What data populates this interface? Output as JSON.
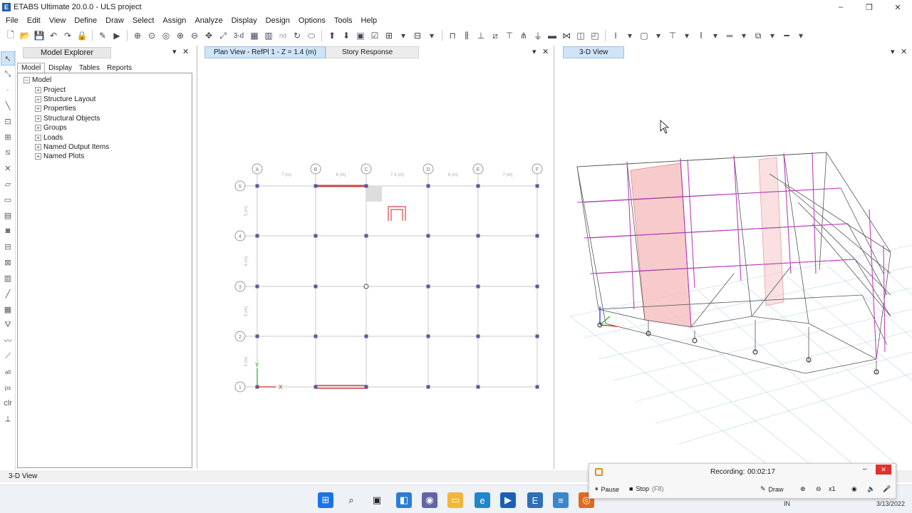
{
  "window": {
    "title": "ETABS Ultimate 20.0.0 - ULS project",
    "app_icon_letter": "E",
    "minimize": "–",
    "maximize": "❐",
    "close": "✕"
  },
  "menu": [
    "File",
    "Edit",
    "View",
    "Define",
    "Draw",
    "Select",
    "Assign",
    "Analyze",
    "Display",
    "Design",
    "Options",
    "Tools",
    "Help"
  ],
  "toolbar": {
    "view3d_label": "3-d",
    "plan_label": "nd"
  },
  "explorer": {
    "title": "Model Explorer",
    "tabs": [
      "Model",
      "Display",
      "Tables",
      "Reports"
    ],
    "root": "Model",
    "items": [
      "Project",
      "Structure Layout",
      "Properties",
      "Structural Objects",
      "Groups",
      "Loads",
      "Named Output Items",
      "Named Plots"
    ]
  },
  "plan_view": {
    "tab_active": "Plan View - RefPl 1 - Z = 1.4 (m)",
    "tab_other": "Story Response",
    "grid_x_labels": [
      "A",
      "B",
      "C",
      "D",
      "E",
      "F"
    ],
    "grid_y_labels": [
      "5",
      "4",
      "3",
      "2",
      "1"
    ],
    "x_spacings": [
      "7 (m)",
      "6 (m)",
      "7.4 (m)",
      "6 (m)",
      "7 (m)"
    ],
    "y_spacings": [
      "5 (m)",
      "5 (m)",
      "5 (m)",
      "5 (m)"
    ],
    "axis_x": "X",
    "axis_y": "Y"
  },
  "view3d": {
    "tab": "3-D View"
  },
  "status": {
    "text": "3-D View"
  },
  "recorder": {
    "label": "Recording:",
    "time": "00:02:17",
    "pause": "Pause",
    "stop": "Stop",
    "stop_key": "(F8)",
    "draw": "Draw",
    "zoom": "x1"
  },
  "tray": {
    "lang": "IN",
    "date": "3/13/2022"
  }
}
